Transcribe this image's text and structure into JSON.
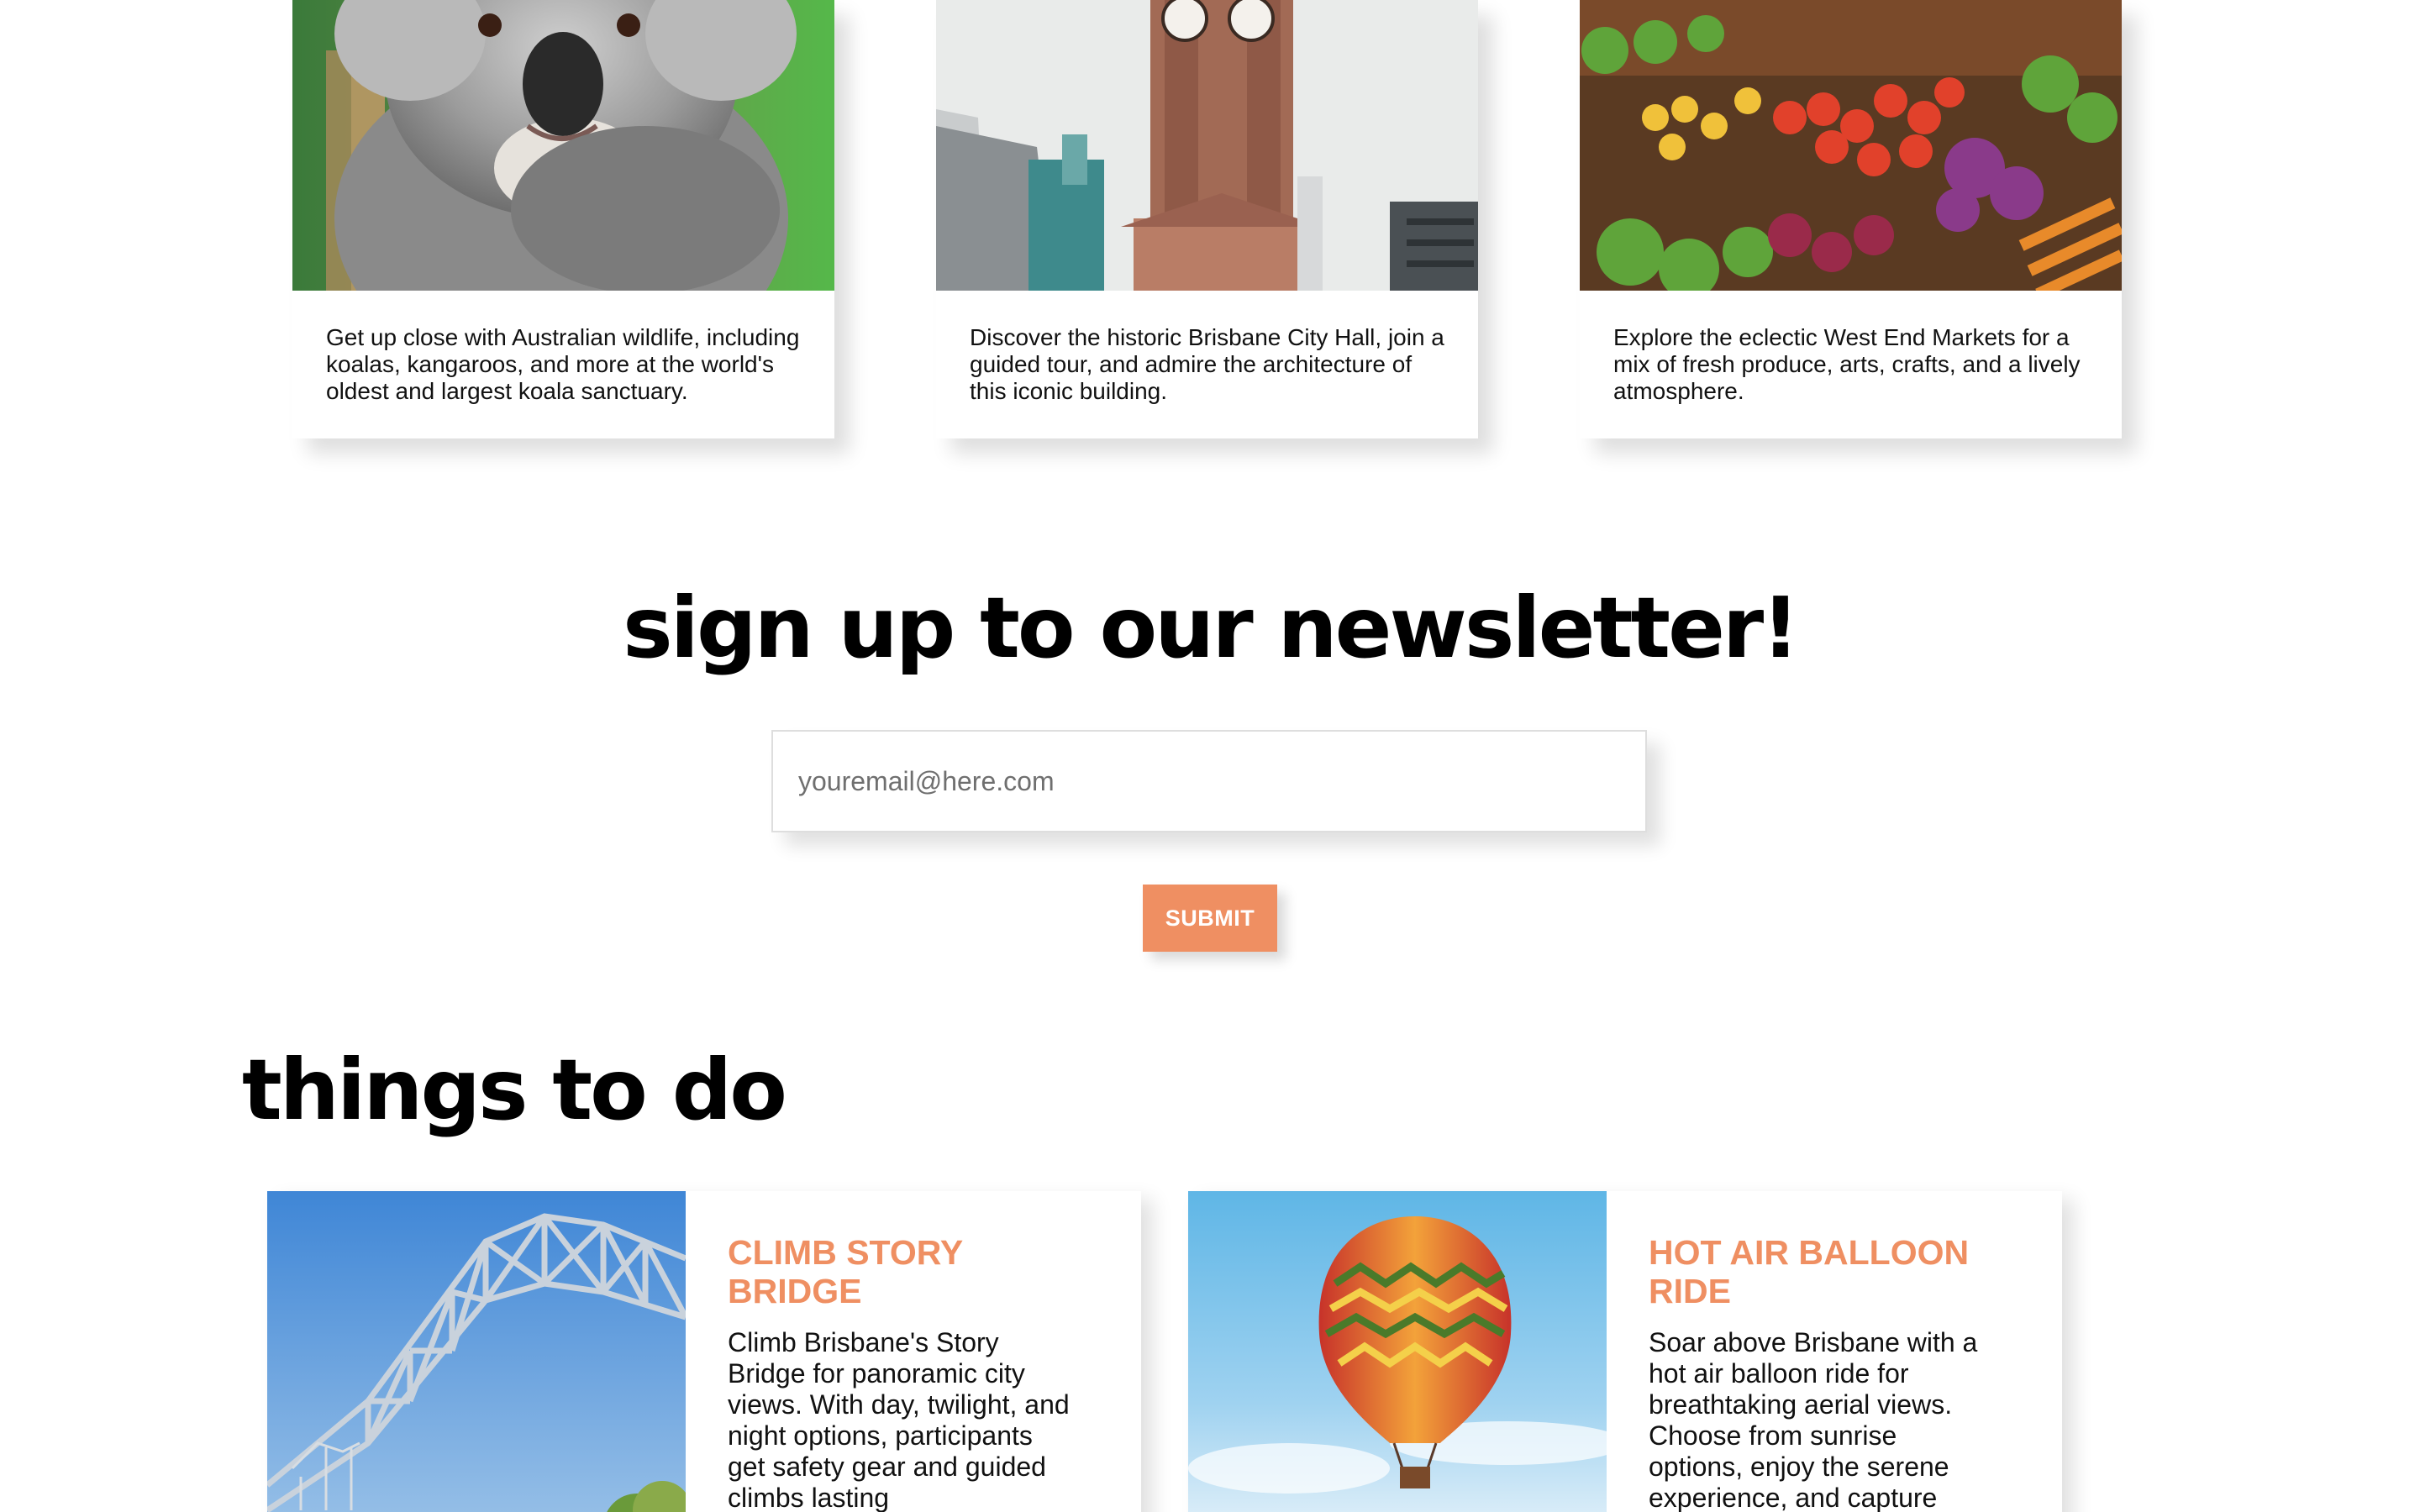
{
  "attractions": [
    {
      "image": "koala photo",
      "description": "Get up close with Australian wildlife, including koalas, kangaroos, and more at the world's oldest and largest koala sanctuary."
    },
    {
      "image": "Brisbane City Hall clock tower photo",
      "description": "Discover the historic Brisbane City Hall, join a guided tour, and admire the architecture of this iconic building."
    },
    {
      "image": "West End Markets produce photo",
      "description": "Explore the eclectic West End Markets for a mix of fresh produce, arts, crafts, and a lively atmosphere."
    }
  ],
  "newsletter": {
    "title": "sign up to our newsletter!",
    "email_placeholder": "youremail@here.com",
    "email_value": "",
    "submit_label": "SUBMIT"
  },
  "things_to_do": {
    "title": "things to do",
    "items": [
      {
        "image": "Story Bridge photo",
        "title": "CLIMB STORY BRIDGE",
        "text": "Climb Brisbane's Story Bridge for panoramic city views. With day, twilight, and night options, participants get safety gear and guided climbs lasting"
      },
      {
        "image": "hot air balloon photo",
        "title": "HOT AIR BALLOON RIDE",
        "text": "Soar above Brisbane with a hot air balloon ride for breathtaking aerial views. Choose from sunrise options, enjoy the serene experience, and capture"
      }
    ]
  },
  "colors": {
    "accent": "#ef8f62",
    "text": "#000000",
    "background": "#ffffff"
  }
}
